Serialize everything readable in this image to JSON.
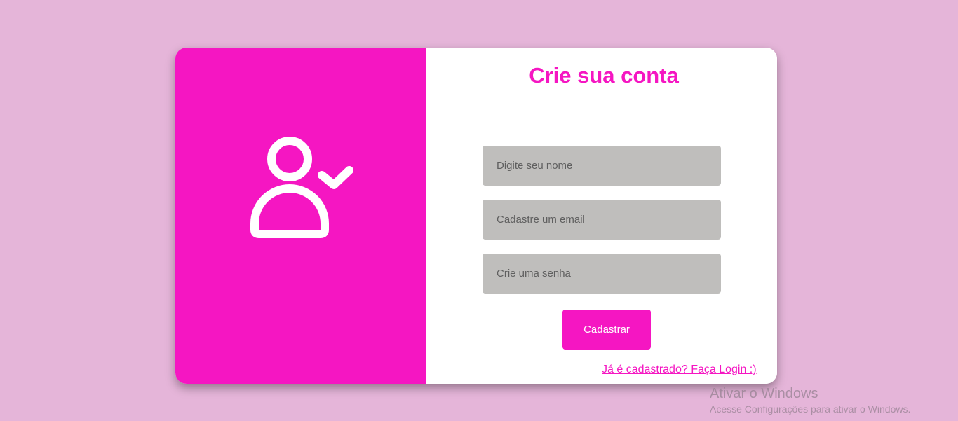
{
  "colors": {
    "background": "#e5b5d9",
    "accent": "#f516c2",
    "field_background": "#bfbebc",
    "card_background": "#ffffff"
  },
  "left_panel": {
    "icon": "user-check-icon"
  },
  "form": {
    "title": "Crie sua conta",
    "name_placeholder": "Digite seu nome",
    "email_placeholder": "Cadastre um email",
    "password_placeholder": "Crie uma senha",
    "submit_label": "Cadastrar",
    "login_link": "Já é cadastrado? Faça Login :)"
  },
  "watermark": {
    "title": "Ativar o Windows",
    "subtitle": "Acesse Configurações para ativar o Windows."
  }
}
